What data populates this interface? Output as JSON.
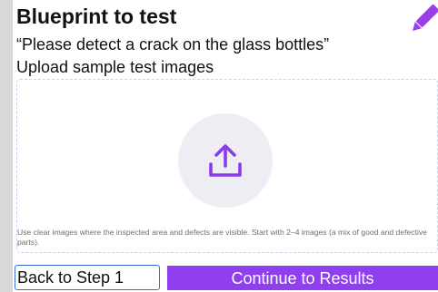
{
  "header": {
    "title": "Blueprint to test",
    "prompt": "“Please detect a crack on the glass bottles”",
    "edit_icon": "pencil-icon"
  },
  "upload": {
    "label": "Upload sample test images",
    "icon": "upload-icon",
    "hint": "Use clear images where the inspected area and defects are visible. Start with 2–4 images (a mix of good and defective parts)."
  },
  "actions": {
    "back_label": "Back to Step 1",
    "continue_label": "Continue to Results"
  },
  "colors": {
    "accent": "#8f3ff0",
    "page_background": "#d9d9d9",
    "upload_circle": "#ededf3",
    "back_border": "#3a6fd8"
  }
}
